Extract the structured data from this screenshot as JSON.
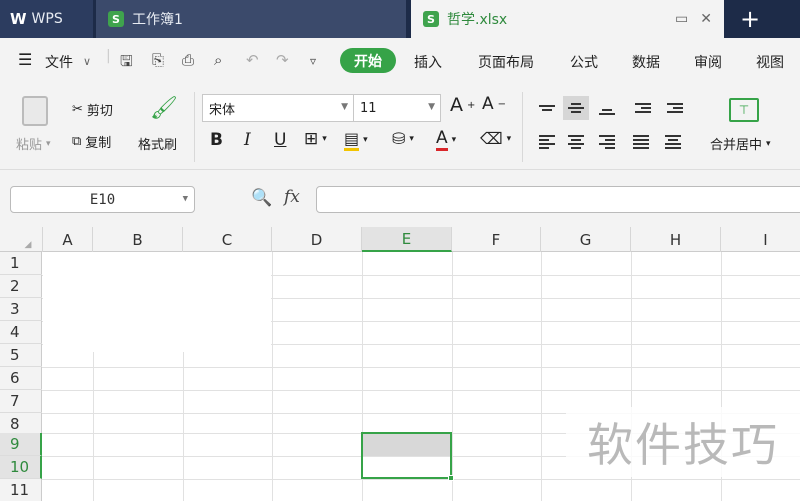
{
  "titlebar": {
    "tabs": [
      {
        "label": "WPS",
        "icon": "wps-logo-icon"
      },
      {
        "label": "工作簿1",
        "icon": "spreadsheet-icon"
      },
      {
        "label": "哲学.xlsx",
        "icon": "spreadsheet-icon",
        "active": true
      }
    ],
    "new_tab": "+",
    "app_badge": "S"
  },
  "menubar": {
    "file_menu": "文件",
    "quick_access": [
      "save-icon",
      "format-painter-icon",
      "print-icon",
      "print-preview-icon",
      "undo-icon",
      "redo-icon",
      "customize-icon"
    ],
    "tabs": [
      "开始",
      "插入",
      "页面布局",
      "公式",
      "数据",
      "审阅",
      "视图"
    ],
    "active_tab": "开始",
    "accent_color": "#36a348"
  },
  "ribbon": {
    "paste": "粘贴",
    "cut": "剪切",
    "copy": "复制",
    "format_painter": "格式刷",
    "font_name": "宋体",
    "font_size": "11",
    "bold": "B",
    "italic": "I",
    "underline": "U",
    "font_color_letter": "A",
    "grow_font": "A",
    "shrink_font": "A",
    "merge_center": "合并居中"
  },
  "formulabar": {
    "name_box": "E10",
    "fx_label": "fx",
    "formula_value": ""
  },
  "sheet": {
    "columns": [
      "A",
      "B",
      "C",
      "D",
      "E",
      "F",
      "G",
      "H",
      "I"
    ],
    "rows": [
      "1",
      "2",
      "3",
      "4",
      "5",
      "6",
      "7",
      "8",
      "9",
      "10",
      "11"
    ],
    "active_column": "E",
    "active_rows": [
      "9",
      "10"
    ]
  },
  "watermark": "软件技巧"
}
